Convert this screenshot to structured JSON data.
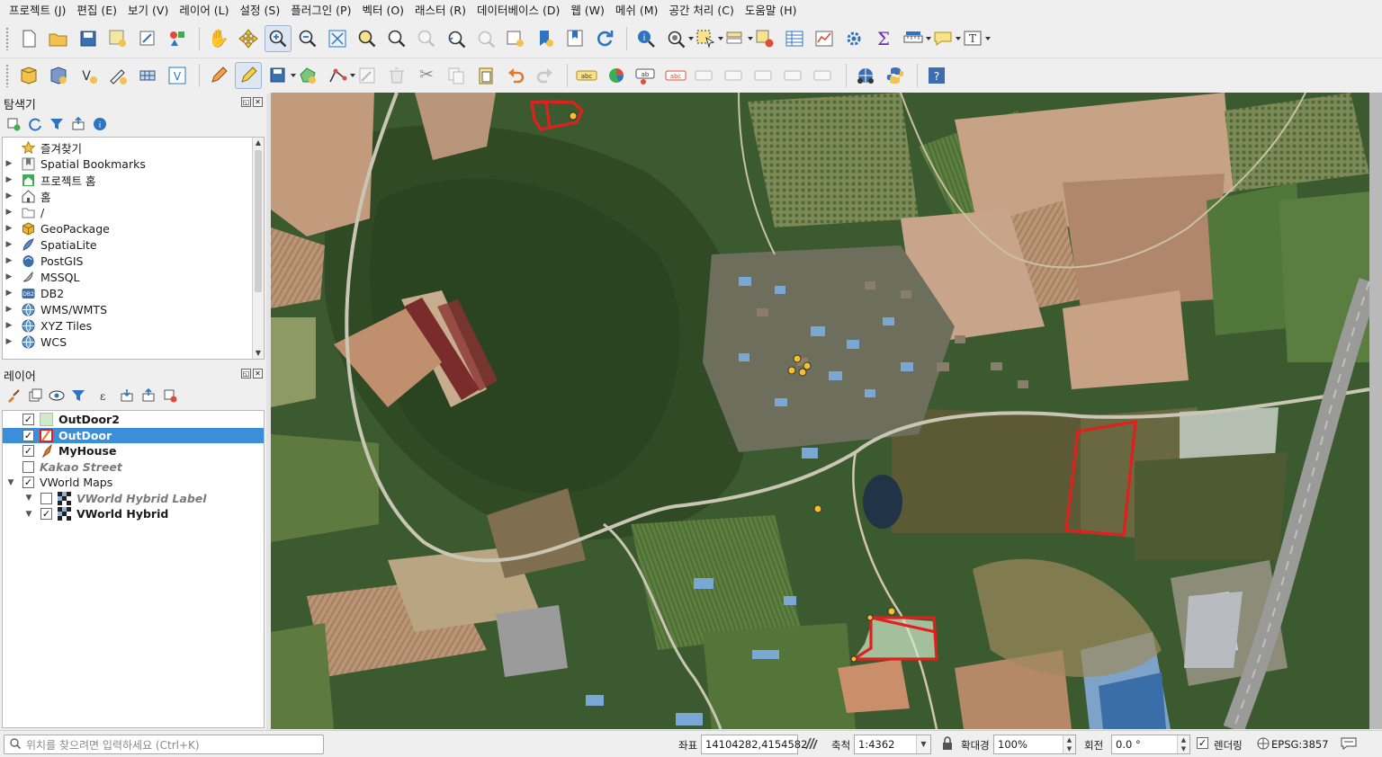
{
  "menu": [
    "프로젝트 (J)",
    "편집 (E)",
    "보기 (V)",
    "레이어 (L)",
    "설정 (S)",
    "플러그인 (P)",
    "벡터 (O)",
    "래스터 (R)",
    "데이터베이스 (D)",
    "웹 (W)",
    "메쉬 (M)",
    "공간 처리 (C)",
    "도움말 (H)"
  ],
  "browser": {
    "title": "탐색기",
    "items": [
      {
        "label": "즐겨찾기",
        "icon": "star-icon"
      },
      {
        "label": "Spatial Bookmarks",
        "icon": "bookmark-icon"
      },
      {
        "label": "프로젝트 홈",
        "icon": "project-home-icon"
      },
      {
        "label": "홈",
        "icon": "home-icon"
      },
      {
        "label": "/",
        "icon": "folder-icon"
      },
      {
        "label": "GeoPackage",
        "icon": "geopackage-icon"
      },
      {
        "label": "SpatiaLite",
        "icon": "spatialite-icon"
      },
      {
        "label": "PostGIS",
        "icon": "postgis-icon"
      },
      {
        "label": "MSSQL",
        "icon": "mssql-icon"
      },
      {
        "label": "DB2",
        "icon": "db2-icon"
      },
      {
        "label": "WMS/WMTS",
        "icon": "globe-icon"
      },
      {
        "label": "XYZ Tiles",
        "icon": "globe-icon"
      },
      {
        "label": "WCS",
        "icon": "globe-icon"
      }
    ]
  },
  "layers": {
    "title": "레이어",
    "items": [
      {
        "name": "OutDoor2",
        "checked": true,
        "symbol": "polygon-fill-icon"
      },
      {
        "name": "OutDoor",
        "checked": true,
        "symbol": "polygon-red-outline-icon"
      },
      {
        "name": "MyHouse",
        "checked": true,
        "symbol": "point-marker-icon"
      },
      {
        "name": "Kakao Street",
        "checked": false,
        "symbol": ""
      },
      {
        "name": "VWorld Maps",
        "checked": true,
        "symbol": ""
      },
      {
        "name": "VWorld Hybrid Label",
        "checked": false,
        "symbol": "raster-icon"
      },
      {
        "name": "VWorld Hybrid",
        "checked": true,
        "symbol": "raster-icon"
      }
    ]
  },
  "status": {
    "locator_placeholder": "위치를 찾으려면 입력하세요 (Ctrl+K)",
    "coordinate_label": "좌표",
    "coordinate": "14104282,4154582",
    "scale_label": "축척",
    "scale": "1:4362",
    "magnifier_label": "확대경",
    "magnifier": "100%",
    "rotation_label": "회전",
    "rotation": "0.0 °",
    "render_label": "렌더링",
    "crs": "EPSG:3857"
  },
  "colors": {
    "selection": "#3a8fd8",
    "polygon_outline": "#e0201e",
    "point_marker": "#f5c029"
  }
}
